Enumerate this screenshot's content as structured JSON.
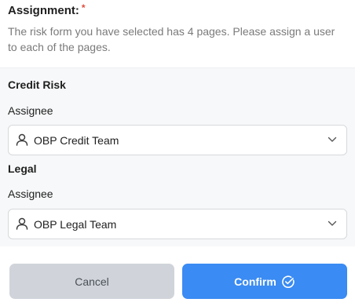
{
  "assignment": {
    "title": "Assignment:",
    "required_marker": "*",
    "description": "The risk form you have selected has 4 pages. Please assign a user to each of the pages."
  },
  "pages": [
    {
      "title": "Credit Risk",
      "assignee_label": "Assignee",
      "assignee_value": "OBP Credit Team",
      "icon": "user-icon"
    },
    {
      "title": "Legal",
      "assignee_label": "Assignee",
      "assignee_value": "OBP Legal Team",
      "icon": "user-icon"
    }
  ],
  "buttons": {
    "cancel_label": "Cancel",
    "confirm_label": "Confirm",
    "confirm_icon": "check-circle-icon"
  },
  "colors": {
    "required": "#e24b3b",
    "confirm_bg": "#3a8bf3",
    "cancel_bg": "#d0d4da",
    "panel_bg": "#f7f8f9"
  }
}
